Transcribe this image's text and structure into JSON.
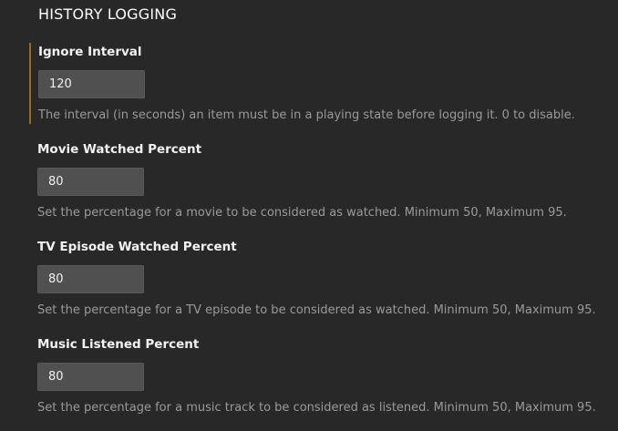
{
  "section": {
    "title": "HISTORY LOGGING"
  },
  "settings": [
    {
      "label": "Ignore Interval",
      "value": "120",
      "description": "The interval (in seconds) an item must be in a playing state before logging it. 0 to disable."
    },
    {
      "label": "Movie Watched Percent",
      "value": "80",
      "description": "Set the percentage for a movie to be considered as watched. Minimum 50, Maximum 95."
    },
    {
      "label": "TV Episode Watched Percent",
      "value": "80",
      "description": "Set the percentage for a TV episode to be considered as watched. Minimum 50, Maximum 95."
    },
    {
      "label": "Music Listened Percent",
      "value": "80",
      "description": "Set the percentage for a music track to be considered as listened. Minimum 50, Maximum 95."
    }
  ],
  "colors": {
    "background": "#282828",
    "focus_accent": "#a06a1a",
    "input_background": "#505050",
    "description_text": "#9a9a9a"
  }
}
